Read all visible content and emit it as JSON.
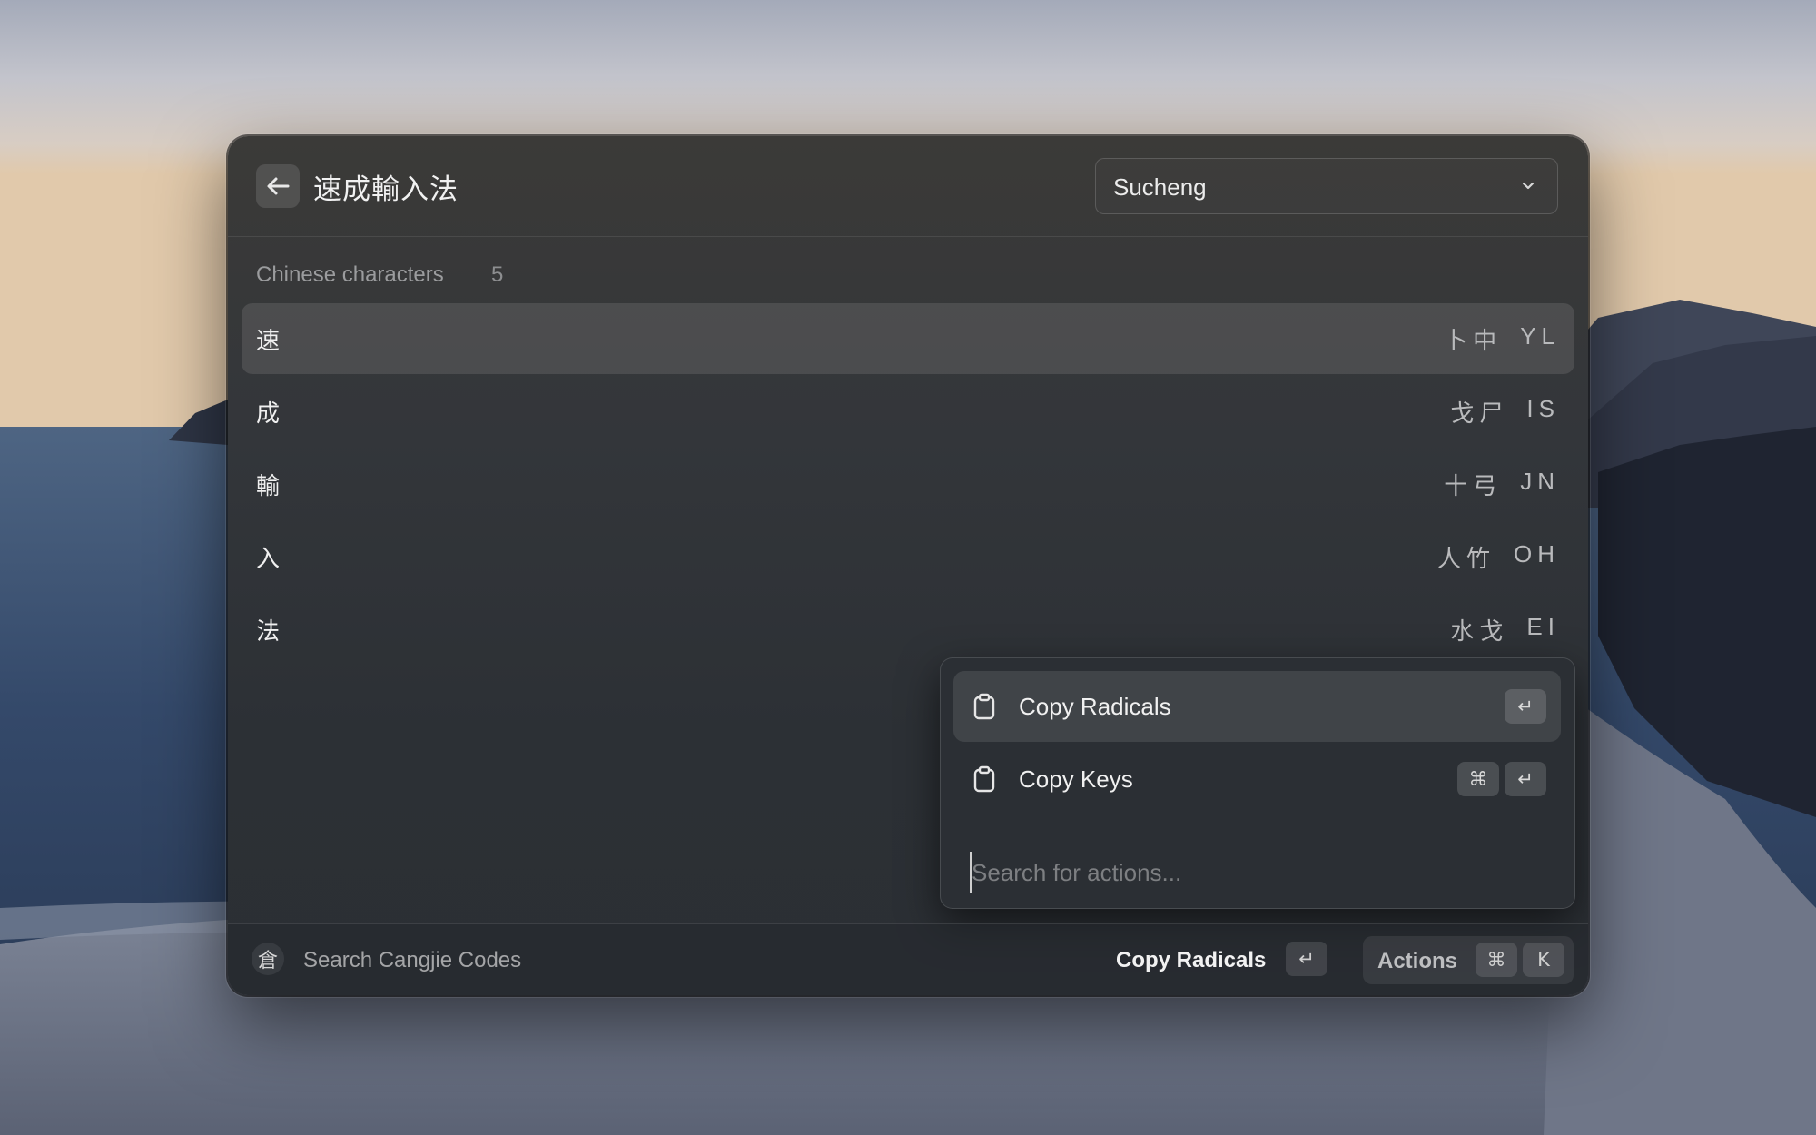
{
  "header": {
    "title": "速成輸入法",
    "dropdown_value": "Sucheng"
  },
  "section": {
    "title": "Chinese characters",
    "count": "5"
  },
  "items": [
    {
      "char": "速",
      "radicals": "卜中",
      "keys": "YL",
      "selected": true
    },
    {
      "char": "成",
      "radicals": "戈尸",
      "keys": "IS",
      "selected": false
    },
    {
      "char": "輸",
      "radicals": "十弓",
      "keys": "JN",
      "selected": false
    },
    {
      "char": "入",
      "radicals": "人竹",
      "keys": "OH",
      "selected": false
    },
    {
      "char": "法",
      "radicals": "水戈",
      "keys": "EI",
      "selected": false
    }
  ],
  "action_panel": {
    "actions": [
      {
        "label": "Copy Radicals",
        "icon": "clipboard-icon",
        "shortcut": [
          "↵"
        ],
        "selected": true
      },
      {
        "label": "Copy Keys",
        "icon": "clipboard-icon",
        "shortcut": [
          "⌘",
          "↵"
        ],
        "selected": false
      }
    ],
    "search_placeholder": "Search for actions..."
  },
  "footer": {
    "icon_glyph": "倉",
    "title": "Search Cangjie Codes",
    "primary_action": "Copy Radicals",
    "primary_shortcut": "↵",
    "actions_label": "Actions",
    "actions_shortcut": [
      "⌘",
      "K"
    ]
  },
  "colors": {
    "window_bg": "#2c3035",
    "selected_bg": "#4a4b4c",
    "text_primary": "#f0f0f0",
    "text_secondary": "#9b9c9e"
  }
}
